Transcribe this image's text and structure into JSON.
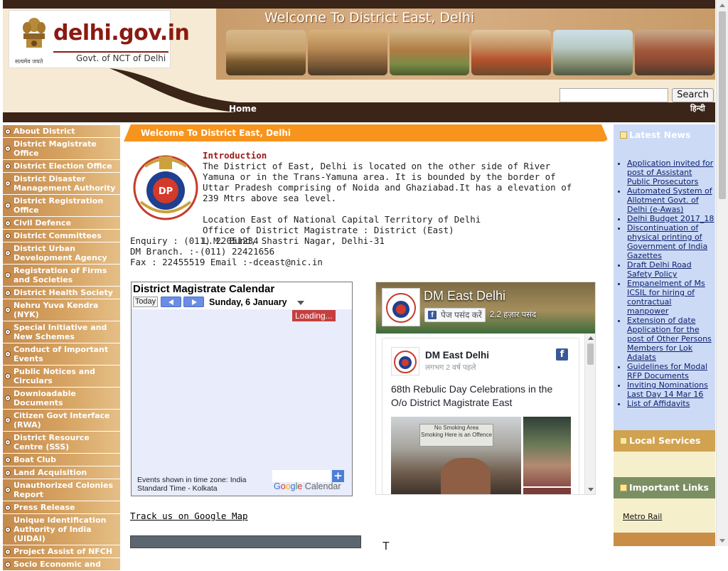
{
  "header": {
    "site_logo": "delhi.gov.in",
    "logo_sub": "Govt. of NCT of Delhi",
    "motto": "सत्यमेव जयते",
    "welcome": "Welcome To District East, Delhi",
    "search_button": "Search",
    "search_placeholder": "",
    "nav_home": "Home",
    "nav_hindi": "हिन्दी"
  },
  "left_menu": [
    "About District",
    "District Magistrate Office",
    "District Election Office",
    "District Disaster Management Authority",
    "District Registration Office",
    "Civil Defence",
    "District Committees",
    "District Urban Development Agency",
    "Registration of Firms and Societies",
    "District Health Society",
    "Nehru Yuva Kendra (NYK)",
    "Special Initiative and New Schemes",
    "Conduct of Important Events",
    "Public Notices and Circulars",
    "Downloadable Documents",
    "Citizen Govt Interface (RWA)",
    "District Resource Centre (SSS)",
    "Boat Club",
    "Land Acquisition",
    "Unauthorized Colonies Report",
    "Press Release",
    "Unique Identification Authority of India (UIDAI)",
    "Project Assist of NFCH",
    "Socio Economic and"
  ],
  "center": {
    "title_bar": "Welcome To District East, Delhi",
    "intro_heading": "Introduction",
    "intro_text": "The District of East, Delhi is located on the other side of River Yamuna or in the Trans-Yamuna area. It is bounded by the border of Uttar Pradesh comprising of Noida and Ghaziabad.It has a elevation of 239 Mtrs above sea level.",
    "location_1": "Location East of National Capital Territory of Delhi",
    "location_2": "Office of District Magistrate : District (East)",
    "location_3": "L.M. Bund, Shastri Nagar, Delhi-31",
    "enquiry": "Enquiry : (011) 22051234",
    "dm_branch": "DM Branch. :-(011) 22421656",
    "fax": "Fax : 22455519 Email :-dceast@nic.in",
    "map_link": "Track us on Google Map"
  },
  "calendar": {
    "title": "District Magistrate Calendar",
    "today_label": "Today",
    "date": "Sunday, 6 January",
    "loading": "Loading...",
    "timezone_note": "Events shown in time zone: India Standard Time - Kolkata",
    "plus": "+",
    "google_g": "G",
    "google_o1": "o",
    "google_o2": "o",
    "google_g2": "g",
    "google_l": "l",
    "google_e": "e",
    "calendar_word": " Calendar"
  },
  "facebook": {
    "page_name": "DM East Delhi",
    "like_label": "पेज पसंद करें",
    "likes_count": "2.2 हज़ार पसंद",
    "post_author": "DM East Delhi",
    "post_time": "लगभग 2 वर्ष पहले",
    "post_text": "68th Rebulic Day Celebrations in the O/o District Magistrate East",
    "photo_sign_1": "No Smoking Area",
    "photo_sign_2": "Smoking Here is an Offence",
    "f_letter": "f"
  },
  "right": {
    "latest_news_title": "Latest News",
    "news": [
      "Application invited for post of Assistant Public Prosecutors",
      "Automated System of Allotment Govt. of Delhi (e-Awas)",
      "Delhi Budget 2017_18",
      "Discontinuation of physical printing of Government of India Gazettes",
      "Draft Delhi Road Safety Policy",
      "Empanelment of Ms ICSIL for hiring of contractual manpower",
      "Extension of date Application for the post of Other Persons Members for Lok Adalats",
      "Guidelines for Modal RFP Documents",
      "Inviting Nominations Last Day 14 Mar 16",
      "List of Affidavits"
    ],
    "local_services_title": "Local Services",
    "important_links_title": "Important Links",
    "important_links": [
      "Metro Rail"
    ]
  },
  "bottom": {
    "partial_text": "T"
  },
  "colors": {
    "menu_bg": "#d7a463",
    "title_bar": "#f7941d",
    "news_bg": "#ccdaf6",
    "intro_heading": "#9a1a1a",
    "header_brown": "#3b2418"
  }
}
